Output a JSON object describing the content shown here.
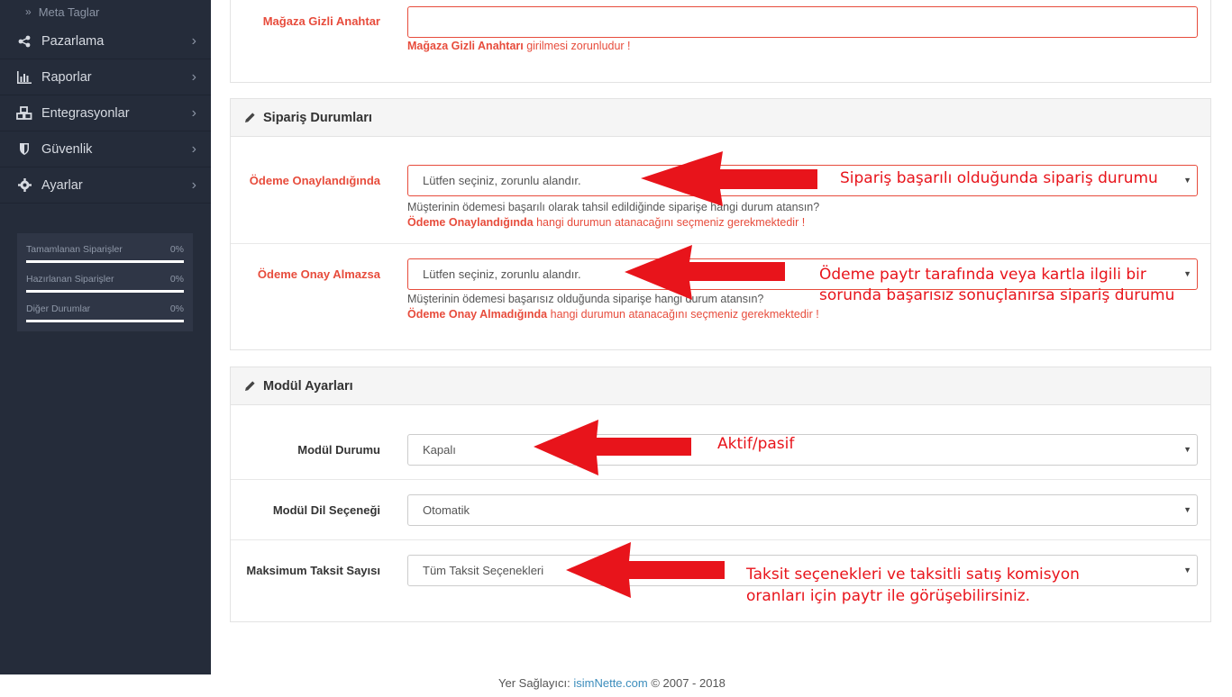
{
  "sidebar": {
    "sub_item": "Meta Taglar",
    "items": [
      {
        "label": "Pazarlama",
        "icon": "share-icon"
      },
      {
        "label": "Raporlar",
        "icon": "bar-chart-icon"
      },
      {
        "label": "Entegrasyonlar",
        "icon": "cubes-icon"
      },
      {
        "label": "Güvenlik",
        "icon": "shield-icon"
      },
      {
        "label": "Ayarlar",
        "icon": "gear-icon"
      }
    ],
    "stats": [
      {
        "label": "Tamamlanan Siparişler",
        "value": "0%"
      },
      {
        "label": "Hazırlanan Siparişler",
        "value": "0%"
      },
      {
        "label": "Diğer Durumlar",
        "value": "0%"
      }
    ]
  },
  "secret_key": {
    "label": "Mağaza Gizli Anahtar",
    "value": "",
    "error_bold": "Mağaza Gizli Anahtarı",
    "error_rest": " girilmesi zorunludur !"
  },
  "order_status": {
    "title": "Sipariş Durumları",
    "approved": {
      "label": "Ödeme Onaylandığında",
      "selected": "Lütfen seçiniz, zorunlu alandır.",
      "help": "Müşterinin ödemesi başarılı olarak tahsil edildiğinde siparişe hangi durum atansın?",
      "error_bold": "Ödeme Onaylandığında",
      "error_rest": " hangi durumun atanacağını seçmeniz gerekmektedir !"
    },
    "not_approved": {
      "label": "Ödeme Onay Almazsa",
      "selected": "Lütfen seçiniz, zorunlu alandır.",
      "help": "Müşterinin ödemesi başarısız olduğunda siparişe hangi durum atansın?",
      "error_bold": "Ödeme Onay Almadığında",
      "error_rest": " hangi durumun atanacağını seçmeniz gerekmektedir !"
    }
  },
  "module_settings": {
    "title": "Modül Ayarları",
    "status": {
      "label": "Modül Durumu",
      "selected": "Kapalı"
    },
    "language": {
      "label": "Modül Dil Seçeneği",
      "selected": "Otomatik"
    },
    "installment": {
      "label": "Maksimum Taksit Sayısı",
      "selected": "Tüm Taksit Seçenekleri"
    }
  },
  "annotations": {
    "a1": "Sipariş başarılı olduğunda sipariş durumu",
    "a2_line1": "Ödeme paytr tarafında veya kartla ilgili bir",
    "a2_line2": "sorunda başarısız sonuçlanırsa sipariş durumu",
    "a3": "Aktif/pasif",
    "a4_line1": "Taksit seçenekleri ve taksitli satış komisyon",
    "a4_line2": "oranları için paytr ile görüşebilirsiniz."
  },
  "footer": {
    "prefix": "Yer Sağlayıcı: ",
    "link": "isimNette.com",
    "suffix": " © 2007 - 2018"
  },
  "colors": {
    "sidebar_bg": "#252c3a",
    "error": "#e74c3c",
    "annotation": "#e8141b"
  }
}
